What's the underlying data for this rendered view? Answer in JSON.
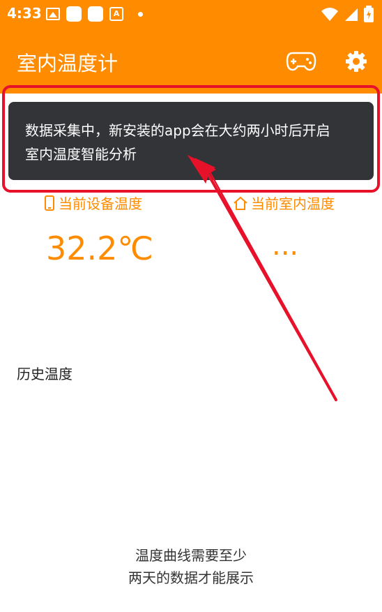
{
  "status_bar": {
    "time": "4:33"
  },
  "app_bar": {
    "title": "室内温度计",
    "icons": [
      "gamepad-icon",
      "gear-icon"
    ]
  },
  "metrics": {
    "device": {
      "label": "当前设备温度",
      "value": "32.2℃",
      "icon": "phone-icon"
    },
    "indoor": {
      "label": "当前室内温度",
      "value": "...",
      "icon": "home-icon"
    }
  },
  "history": {
    "title": "历史温度",
    "empty_line1": "温度曲线需要至少",
    "empty_line2": "两天的数据才能展示"
  },
  "toast": {
    "line1": "数据采集中，新安装的app会在大约两小时后开启",
    "line2": "室内温度智能分析"
  },
  "colors": {
    "accent": "#ff8c00",
    "toast_bg": "#333438",
    "annotation": "#e8112a"
  }
}
